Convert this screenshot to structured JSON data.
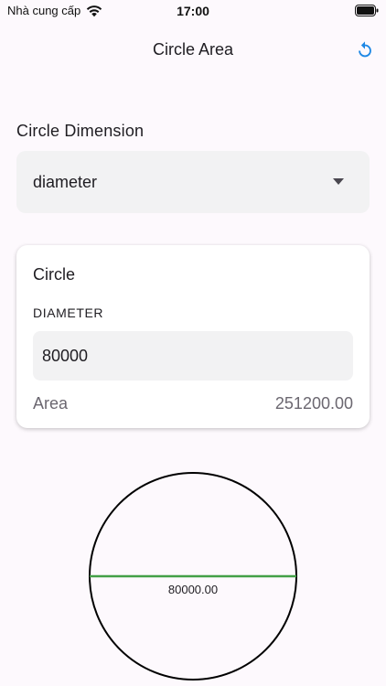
{
  "status_bar": {
    "carrier": "Nhà cung cấp",
    "time": "17:00",
    "wifi_icon": "wifi-icon",
    "battery_icon": "battery-icon"
  },
  "app_bar": {
    "title": "Circle Area",
    "reset_icon": "refresh-icon",
    "accent_color": "#1e88e5"
  },
  "dimension": {
    "label": "Circle Dimension",
    "selected": "diameter"
  },
  "card": {
    "title": "Circle",
    "field_label": "DIAMETER",
    "field_value": "80000",
    "result_label": "Area",
    "result_value": "251200.00"
  },
  "diagram": {
    "diameter_label": "80000.00",
    "line_color": "#43a047",
    "circle_color": "#000000"
  }
}
